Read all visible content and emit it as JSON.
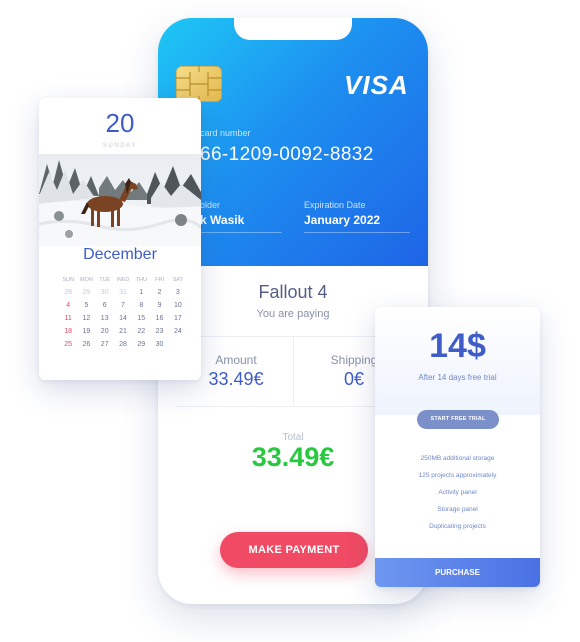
{
  "card": {
    "brand": "VISA",
    "number_label": "card number",
    "number": "66-1209-0092-8832",
    "holder_label": "older",
    "holder": "k Wasik",
    "expiry_label": "Expiration Date",
    "expiry": "January 2022"
  },
  "payment": {
    "product": "Fallout 4",
    "subtitle": "You are paying",
    "amount_label": "Amount",
    "amount": "33.49€",
    "shipping_label": "Shipping",
    "shipping": "0€",
    "total_label": "Total",
    "total": "33.49€",
    "pay_button": "MAKE PAYMENT"
  },
  "calendar": {
    "day": "20",
    "weekday": "SUNDAY",
    "month": "December",
    "weekdays": [
      "SUN",
      "MON",
      "TUE",
      "WED",
      "THU",
      "FRI",
      "SAT"
    ],
    "rows": [
      [
        "28",
        "29",
        "30",
        "31",
        "1",
        "2",
        "3"
      ],
      [
        "4",
        "5",
        "6",
        "7",
        "8",
        "9",
        "10"
      ],
      [
        "11",
        "12",
        "13",
        "14",
        "15",
        "16",
        "17"
      ],
      [
        "18",
        "19",
        "20",
        "21",
        "22",
        "23",
        "24"
      ],
      [
        "25",
        "26",
        "27",
        "28",
        "29",
        "30",
        ""
      ]
    ]
  },
  "pricing": {
    "price": "14$",
    "subtitle": "After 14 days free trial",
    "trial_button": "START FREE TRIAL",
    "features": [
      "250MB additional storage",
      "125 projects approximately",
      "Activity panel",
      "Storage panel",
      "Duplicating projects"
    ],
    "purchase_button": "PURCHASE"
  },
  "colors": {
    "accent": "#3f5cc7",
    "pay": "#f04a64",
    "total": "#28c840",
    "weekend": "#e74860"
  }
}
